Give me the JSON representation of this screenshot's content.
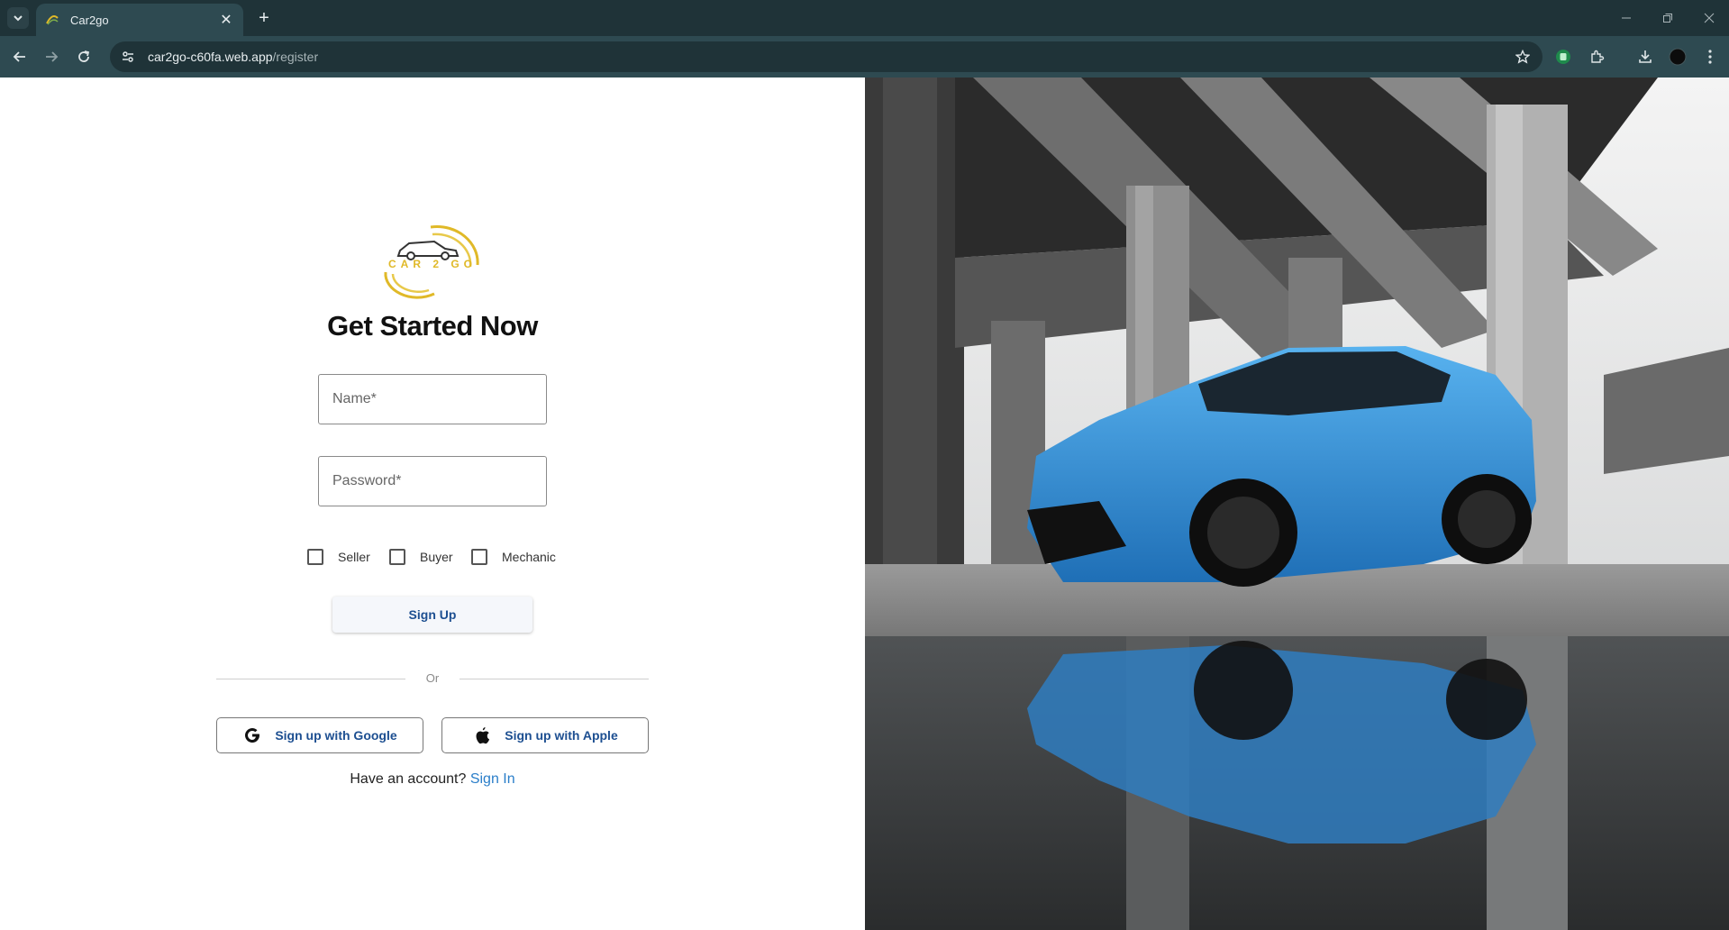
{
  "browser": {
    "tab": {
      "title": "Car2go"
    },
    "url": {
      "host": "car2go-c60fa.web.app",
      "path": "/register"
    }
  },
  "page": {
    "logo_text": "CAR 2 GO",
    "heading": "Get Started Now",
    "form": {
      "name_placeholder": "Name*",
      "password_placeholder": "Password*",
      "roles": [
        {
          "label": "Seller",
          "checked": false
        },
        {
          "label": "Buyer",
          "checked": false
        },
        {
          "label": "Mechanic",
          "checked": false
        }
      ],
      "submit_label": "Sign Up"
    },
    "divider_text": "Or",
    "social": {
      "google_label": "Sign up with Google",
      "apple_label": "Sign up with Apple"
    },
    "have_account_text": "Have an account?",
    "sign_in_link": "Sign In"
  },
  "colors": {
    "accent_blue": "#1d4f91",
    "link_blue": "#2a7ec9",
    "logo_gold": "#e0b928",
    "car_blue": "#2e8fd6",
    "chrome_dark": "#1f3338",
    "chrome_toolbar": "#2e4a51"
  },
  "icons": {
    "tab_search": "chevron-down-icon",
    "back": "arrow-left-icon",
    "forward": "arrow-right-icon",
    "reload": "reload-icon",
    "bookmark": "star-icon",
    "extensions": "puzzle-icon",
    "downloads": "download-icon",
    "menu": "kebab-icon"
  },
  "hero": {
    "alt": "Blue hatchback car parked under a concrete overpass with reflection in a puddle"
  }
}
